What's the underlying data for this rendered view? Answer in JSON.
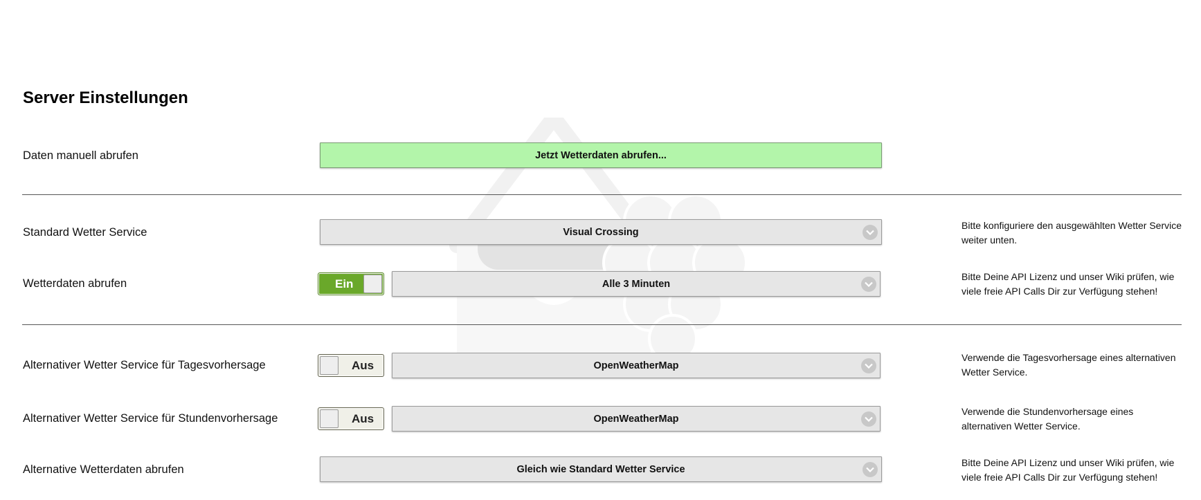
{
  "page": {
    "title": "Server Einstellungen"
  },
  "manual": {
    "label": "Daten manuell abrufen",
    "button_label": "Jetzt Wetterdaten abrufen..."
  },
  "standard_service": {
    "label": "Standard Wetter Service",
    "selected": "Visual Crossing",
    "hint": "Bitte konfiguriere den ausgewählten Wetter Service weiter unten."
  },
  "fetch_interval": {
    "label": "Wetterdaten abrufen",
    "toggle_label": "Ein",
    "toggle_on": true,
    "selected": "Alle 3 Minuten",
    "hint": "Bitte Deine API Lizenz und unser Wiki prüfen, wie viele freie API Calls Dir zur Verfügung stehen!"
  },
  "alt_daily": {
    "label": "Alternativer Wetter Service für Tagesvorhersage",
    "toggle_label": "Aus",
    "toggle_on": false,
    "selected": "OpenWeatherMap",
    "hint": "Verwende die Tagesvorhersage eines alternativen Wetter Service."
  },
  "alt_hourly": {
    "label": "Alternativer Wetter Service für Stundenvorhersage",
    "toggle_label": "Aus",
    "toggle_on": false,
    "selected": "OpenWeatherMap",
    "hint": "Verwende die Stundenvorhersage eines alternativen Wetter Service."
  },
  "alt_fetch": {
    "label": "Alternative Wetterdaten abrufen",
    "selected": "Gleich wie Standard Wetter Service",
    "hint": "Bitte Deine API Lizenz und unser Wiki prüfen, wie viele freie API Calls Dir zur Verfügung stehen!"
  },
  "colors": {
    "fetch_button_bg": "#b3f5aa",
    "toggle_on_bg": "#6aa82a",
    "select_bg": "#e6e6e6"
  },
  "icons": {
    "select_arrow": "chevron-down-icon",
    "watermark": "house-raspberry-logo"
  }
}
